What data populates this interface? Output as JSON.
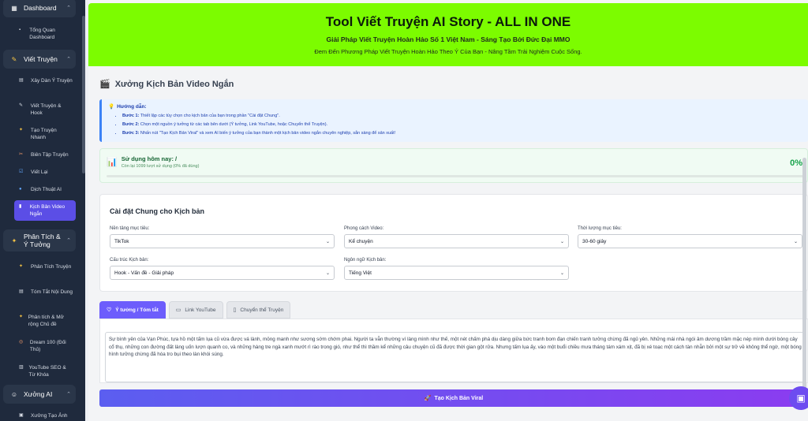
{
  "sidebar": {
    "sections": [
      {
        "label": "Dashboard",
        "icon": "dashboard-icon"
      },
      {
        "label": "Viết Truyện",
        "icon": "pen-icon"
      },
      {
        "label": "Phân Tích & Ý Tưởng",
        "icon": "sparkle-icon"
      },
      {
        "label": "Xưởng AI",
        "icon": "robot-icon"
      }
    ],
    "items": [
      {
        "label": "Tổng Quan Dashboard"
      },
      {
        "label": "Xây Dàn Ý Truyện"
      },
      {
        "label": "Viết Truyện & Hook"
      },
      {
        "label": "Tạo Truyện Nhanh"
      },
      {
        "label": "Biên Tập Truyện"
      },
      {
        "label": "Viết Lại"
      },
      {
        "label": "Dịch Thuật AI"
      },
      {
        "label": "Kịch Bản Video Ngắn"
      },
      {
        "label": "Phân Tích Truyện"
      },
      {
        "label": "Tóm Tắt Nội Dung"
      },
      {
        "label": "Phân tích & Mở rộng Chủ đề"
      },
      {
        "label": "Dream 100 (Đối Thủ)"
      },
      {
        "label": "YouTube SEO & Từ Khóa"
      },
      {
        "label": "Xưởng Tạo Ảnh"
      }
    ]
  },
  "hero": {
    "title": "Tool Viết Truyện AI Story - ALL IN ONE",
    "subtitle": "Giải Pháp Viết Truyện Hoàn Hảo Số 1 Việt Nam - Sáng Tạo Bởi Đức Đại MMO",
    "tagline": "Đem Đến Phương Pháp Viết Truyện Hoàn Hảo Theo Ý Của Bạn - Nâng Tầm Trải Nghiệm Cuộc Sống.",
    "bg_color": "#7cfc00"
  },
  "page": {
    "title": "Xưởng Kịch Bản Video Ngắn",
    "icon": "clapperboard-icon"
  },
  "guide": {
    "title": "Hướng dẫn:",
    "steps": [
      {
        "step": "Bước 1:",
        "text": " Thiết lập các tùy chọn cho kịch bản của bạn trong phần \"Cài đặt Chung\"."
      },
      {
        "step": "Bước 2:",
        "text": " Chọn một nguồn ý tưởng từ các tab bên dưới (Ý tưởng, Link YouTube, hoặc Chuyển thể Truyện)."
      },
      {
        "step": "Bước 3:",
        "text": " Nhấn nút \"Tạo Kịch Bản Viral\" và xem AI biến ý tưởng của bạn thành một kịch bản video ngắn chuyên nghiệp, sẵn sàng để sản xuất!"
      }
    ]
  },
  "usage": {
    "title": "Sử dụng hôm nay: /",
    "remaining": "Còn lại 1099 lượt sử dụng (0% đã dùng)",
    "percent_label": "0%",
    "progress": 0
  },
  "settings": {
    "title": "Cài đặt Chung cho Kịch bản",
    "fields": [
      {
        "label": "Nền tảng mục tiêu:",
        "value": "TikTok"
      },
      {
        "label": "Phong cách Video:",
        "value": "Kể chuyện"
      },
      {
        "label": "Thời lượng mục tiêu:",
        "value": "30-60 giây"
      },
      {
        "label": "Cấu trúc Kịch bản:",
        "value": "Hook - Vấn đề - Giải pháp"
      },
      {
        "label": "Ngôn ngữ Kịch bản:",
        "value": "Tiếng Việt"
      }
    ]
  },
  "tabs": [
    {
      "label": "Ý tưởng / Tóm tắt",
      "icon": "lightbulb-icon"
    },
    {
      "label": "Link YouTube",
      "icon": "video-icon"
    },
    {
      "label": "Chuyển thể Truyện",
      "icon": "book-icon"
    }
  ],
  "story": {
    "text": "Sự bình yên của Vạn Phúc, tựa hồ một tấm lụa cũ vừa được vá lành, mỏng manh như sương sớm chớm phai. Người ta vẫn thường ví làng mình như thế, một nét chấm phá dịu dàng giữa bức tranh bom đạn chiến tranh tưởng chừng đã ngủ yên. Những mái nhà ngói âm dương trầm mặc nép mình dưới bóng cây cổ thụ, những con đường đất làng uốn lượn quanh co, và những hàng tre ngà xanh mướt rì rào trong gió, như thể thì thầm kể những câu chuyện cũ đã được thời gian gột rửa. Nhưng tấm lụa ấy, vào một buổi chiều mưa tháng tám xám xịt, đã bị xé toạc một cách tàn nhẫn bởi một sự trở về không thể ngờ, một bóng hình tưởng chừng đã hóa tro bụi theo làn khói súng."
  },
  "submit": {
    "label": "Tạo Kịch Bản Viral",
    "icon": "rocket-icon"
  }
}
